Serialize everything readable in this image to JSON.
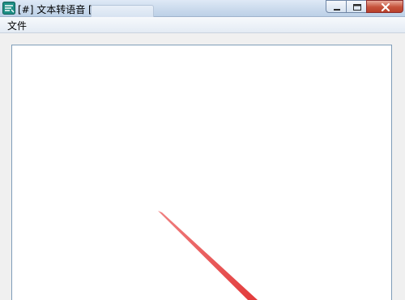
{
  "window": {
    "title": "[#] 文本转语音 [#]",
    "icons": {
      "app": "speech-text-app-icon",
      "minimize": "minimize-icon",
      "maximize": "maximize-icon",
      "close": "close-icon"
    }
  },
  "menu": {
    "items": [
      {
        "label": "文件"
      }
    ]
  },
  "editor": {
    "value": "",
    "placeholder": ""
  },
  "colors": {
    "titlebar": "#c9d9ec",
    "close_button": "#c6523b",
    "editor_border": "#7f9db9",
    "annotation_arrow": "#e23b3b"
  }
}
